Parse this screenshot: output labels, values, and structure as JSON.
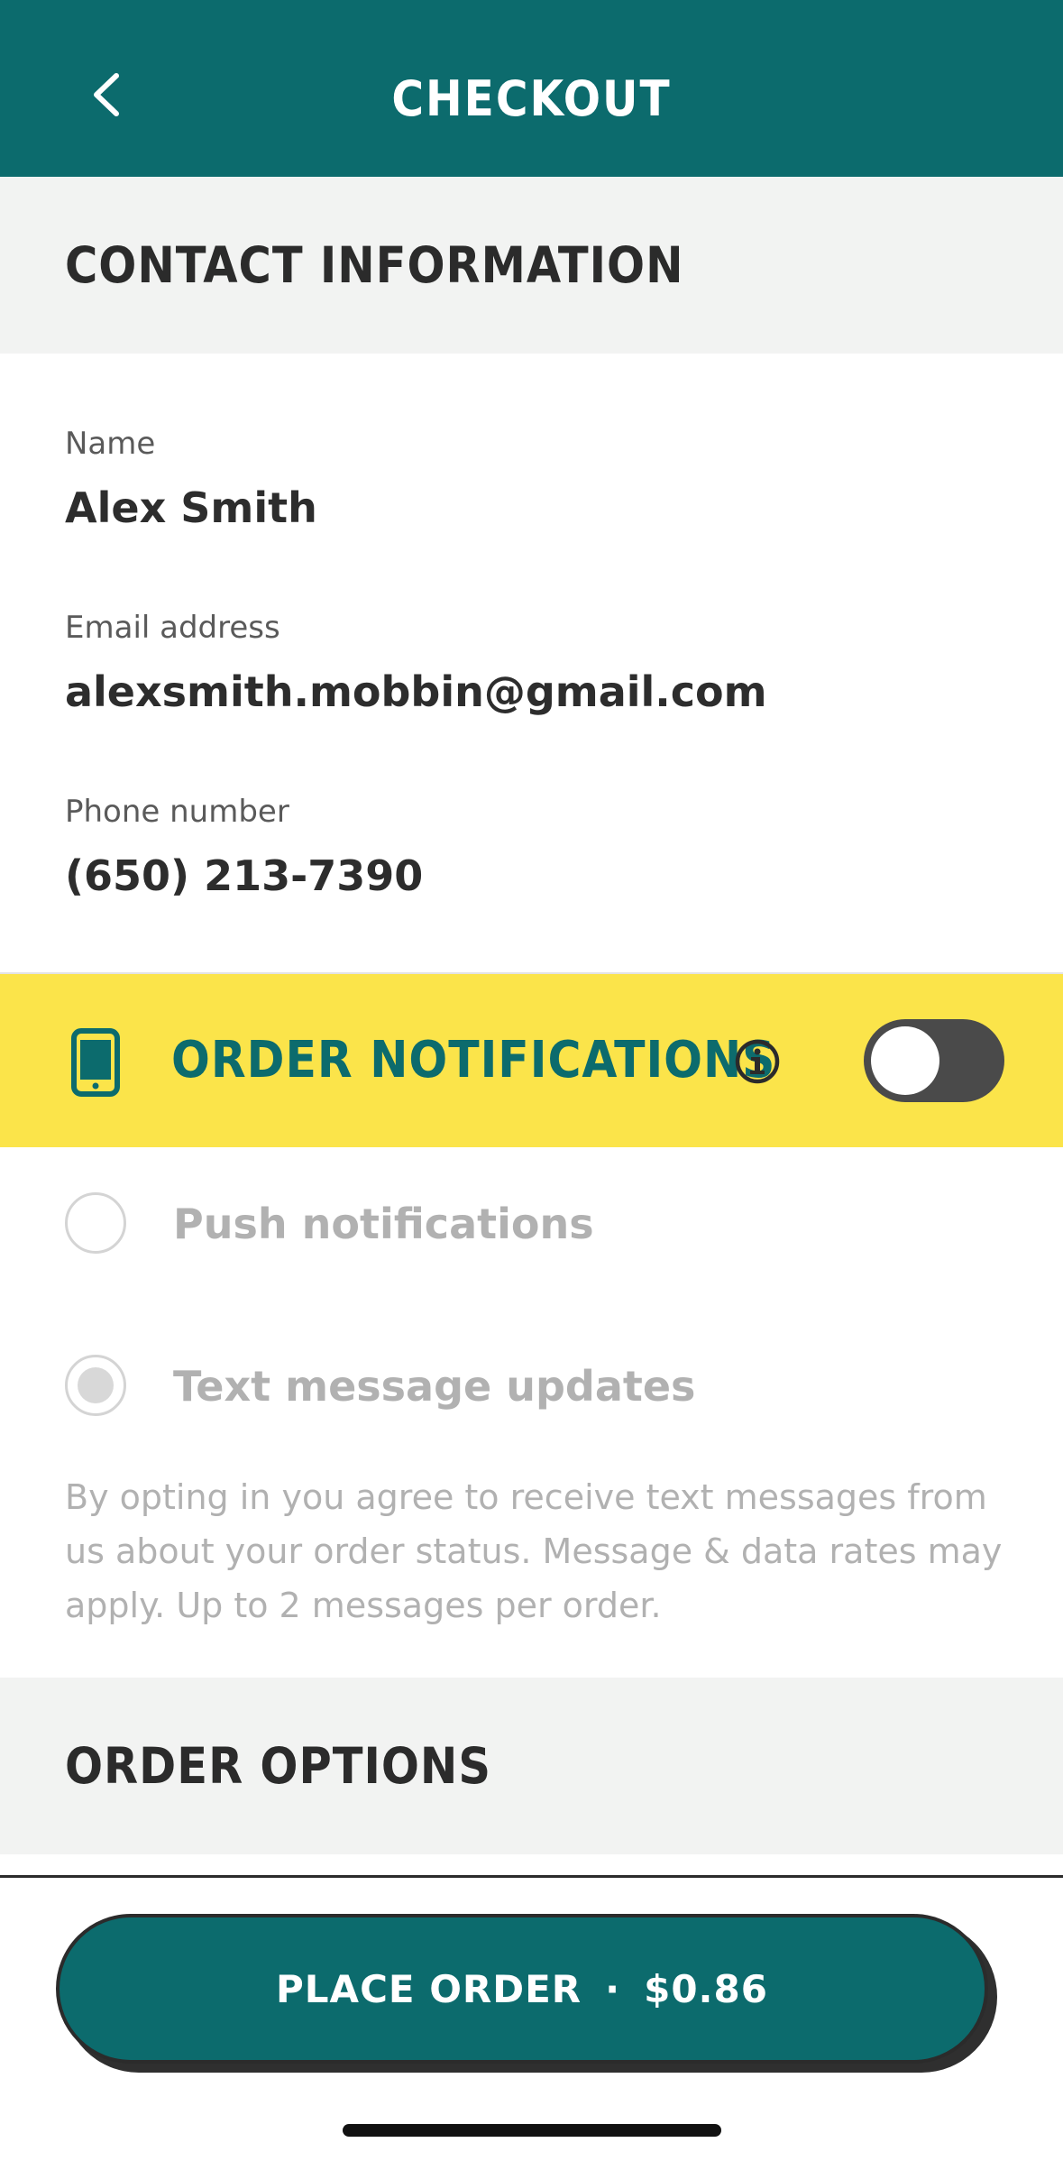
{
  "header": {
    "title": "CHECKOUT"
  },
  "contact": {
    "heading": "CONTACT INFORMATION",
    "fields": [
      {
        "label": "Name",
        "value": "Alex Smith"
      },
      {
        "label": "Email address",
        "value": "alexsmith.mobbin@gmail.com"
      },
      {
        "label": "Phone number",
        "value": "(650) 213-7390"
      }
    ]
  },
  "notifications": {
    "title": "ORDER NOTIFICATIONS",
    "toggle_on": false,
    "options": [
      {
        "label": "Push notifications",
        "selected": false
      },
      {
        "label": "Text message updates",
        "selected": true
      }
    ],
    "disclaimer": "By opting in you agree to receive text messages from us about your order status. Message & data rates may apply. Up to 2 messages per order."
  },
  "order_options": {
    "heading": "ORDER OPTIONS"
  },
  "place_order": {
    "label": "PLACE ORDER",
    "separator": "·",
    "total": "$0.86"
  },
  "colors": {
    "brand": "#0c6b6d",
    "banner": "#fbe44a",
    "section_bg": "#f2f3f2"
  },
  "icons": [
    "chevron-left-icon",
    "phone-icon",
    "info-icon"
  ]
}
